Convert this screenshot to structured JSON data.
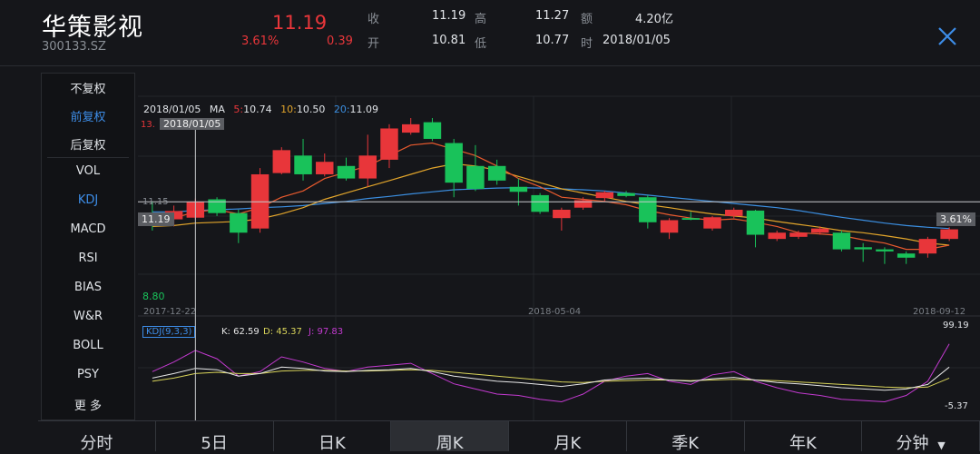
{
  "header": {
    "name": "华策影视",
    "code": "300133.SZ",
    "price": "11.19",
    "change_pct": "3.61%",
    "change_amt": "0.39",
    "stats": [
      {
        "label": "收",
        "value": "11.19"
      },
      {
        "label": "高",
        "value": "11.27"
      },
      {
        "label": "额",
        "value": "4.20亿"
      },
      {
        "label": "开",
        "value": "10.81"
      },
      {
        "label": "低",
        "value": "10.77"
      },
      {
        "label": "时",
        "value": "2018/01/05"
      }
    ]
  },
  "side_menu": {
    "rights": [
      "不复权",
      "前复权",
      "后复权"
    ],
    "indicators": [
      "VOL",
      "KDJ",
      "MACD",
      "RSI",
      "BIAS",
      "W&R",
      "BOLL",
      "PSY",
      "更 多"
    ],
    "active_right": "前复权",
    "active_indicator": "KDJ"
  },
  "overlay": {
    "date": "2018/01/05",
    "ma_label": "MA",
    "ma5_label": "5:",
    "ma5": "10.74",
    "ma10_label": "10:",
    "ma10": "10.50",
    "ma20_label": "20:",
    "ma20": "11.09",
    "crosshair_date": "2018/01/05",
    "crosshair_price": "11.19",
    "crosshair_pct": "3.61%",
    "top_price": "13.",
    "level_price": "11.15",
    "low_price": "8.80",
    "x_dates": [
      "2017-12-22",
      "2018-05-04",
      "2018-09-12"
    ],
    "kdj_name": "KDJ(9,3,3)",
    "kdj_k": "K: 62.59",
    "kdj_d": "D: 45.37",
    "kdj_j": "J: 97.83",
    "kdj_max": "99.19",
    "kdj_min": "-5.37"
  },
  "colors": {
    "up": "#e8363a",
    "down": "#19c25a",
    "ma5": "#e85a2e",
    "ma10": "#e2a52b",
    "ma20": "#3b8ee0",
    "k": "#e8e8e8",
    "d": "#d9d45a",
    "j": "#c33ad0",
    "accent": "#3d8de8"
  },
  "chart_data": {
    "type": "candlestick",
    "y_range": [
      8.8,
      13.2
    ],
    "candles": [
      {
        "o": 10.92,
        "c": 10.75,
        "h": 11.2,
        "l": 10.5
      },
      {
        "o": 10.77,
        "c": 10.97,
        "h": 11.1,
        "l": 10.6
      },
      {
        "o": 10.81,
        "c": 11.19,
        "h": 11.27,
        "l": 10.77
      },
      {
        "o": 11.25,
        "c": 10.92,
        "h": 11.3,
        "l": 10.85
      },
      {
        "o": 10.92,
        "c": 10.45,
        "h": 11.0,
        "l": 10.2
      },
      {
        "o": 10.55,
        "c": 11.85,
        "h": 12.0,
        "l": 10.45
      },
      {
        "o": 11.88,
        "c": 12.43,
        "h": 12.5,
        "l": 11.85
      },
      {
        "o": 12.3,
        "c": 11.85,
        "h": 12.7,
        "l": 11.7
      },
      {
        "o": 11.85,
        "c": 12.15,
        "h": 12.35,
        "l": 11.8
      },
      {
        "o": 12.05,
        "c": 11.75,
        "h": 12.25,
        "l": 11.7
      },
      {
        "o": 11.75,
        "c": 12.3,
        "h": 12.8,
        "l": 11.55
      },
      {
        "o": 12.2,
        "c": 12.95,
        "h": 13.05,
        "l": 12.0
      },
      {
        "o": 12.85,
        "c": 13.05,
        "h": 13.2,
        "l": 12.8
      },
      {
        "o": 13.1,
        "c": 12.7,
        "h": 13.2,
        "l": 12.65
      },
      {
        "o": 12.6,
        "c": 11.65,
        "h": 12.7,
        "l": 11.3
      },
      {
        "o": 12.05,
        "c": 11.5,
        "h": 12.55,
        "l": 11.45
      },
      {
        "o": 12.05,
        "c": 11.7,
        "h": 12.2,
        "l": 11.6
      },
      {
        "o": 11.55,
        "c": 11.43,
        "h": 11.75,
        "l": 11.1
      },
      {
        "o": 11.35,
        "c": 10.95,
        "h": 11.4,
        "l": 10.9
      },
      {
        "o": 10.8,
        "c": 11.0,
        "h": 11.05,
        "l": 10.5
      },
      {
        "o": 11.05,
        "c": 11.23,
        "h": 11.3,
        "l": 11.0
      },
      {
        "o": 11.28,
        "c": 11.42,
        "h": 11.45,
        "l": 11.2
      },
      {
        "o": 11.4,
        "c": 11.33,
        "h": 11.45,
        "l": 11.3
      },
      {
        "o": 11.3,
        "c": 10.7,
        "h": 11.35,
        "l": 10.55
      },
      {
        "o": 10.45,
        "c": 10.75,
        "h": 10.8,
        "l": 10.3
      },
      {
        "o": 10.8,
        "c": 10.76,
        "h": 10.95,
        "l": 10.75
      },
      {
        "o": 10.55,
        "c": 10.82,
        "h": 10.85,
        "l": 10.5
      },
      {
        "o": 10.85,
        "c": 11.0,
        "h": 11.05,
        "l": 10.8
      },
      {
        "o": 10.98,
        "c": 10.4,
        "h": 11.0,
        "l": 10.1
      },
      {
        "o": 10.3,
        "c": 10.45,
        "h": 10.5,
        "l": 10.25
      },
      {
        "o": 10.35,
        "c": 10.45,
        "h": 10.5,
        "l": 10.3
      },
      {
        "o": 10.45,
        "c": 10.55,
        "h": 10.6,
        "l": 10.4
      },
      {
        "o": 10.45,
        "c": 10.05,
        "h": 10.5,
        "l": 10.0
      },
      {
        "o": 10.1,
        "c": 10.05,
        "h": 10.2,
        "l": 9.75
      },
      {
        "o": 10.05,
        "c": 10.0,
        "h": 10.1,
        "l": 9.7
      },
      {
        "o": 9.95,
        "c": 9.85,
        "h": 10.0,
        "l": 9.7
      },
      {
        "o": 9.95,
        "c": 10.3,
        "h": 10.35,
        "l": 9.85
      },
      {
        "o": 10.3,
        "c": 10.53,
        "h": 10.58,
        "l": 10.25
      }
    ],
    "ma5": [
      10.7,
      10.8,
      10.95,
      11.0,
      10.9,
      11.05,
      11.3,
      11.45,
      11.75,
      11.9,
      12.05,
      12.3,
      12.55,
      12.6,
      12.45,
      12.3,
      12.05,
      11.75,
      11.55,
      11.3,
      11.25,
      11.2,
      11.12,
      10.98,
      10.88,
      10.8,
      10.75,
      10.78,
      10.7,
      10.6,
      10.45,
      10.42,
      10.38,
      10.28,
      10.2,
      10.05,
      10.05,
      10.15
    ],
    "ma10": [
      10.6,
      10.62,
      10.68,
      10.7,
      10.72,
      10.78,
      10.9,
      11.05,
      11.25,
      11.4,
      11.55,
      11.7,
      11.85,
      12.0,
      12.1,
      12.05,
      11.95,
      11.8,
      11.65,
      11.5,
      11.4,
      11.3,
      11.2,
      11.12,
      11.05,
      10.97,
      10.9,
      10.85,
      10.8,
      10.72,
      10.65,
      10.58,
      10.5,
      10.45,
      10.38,
      10.3,
      10.2,
      10.15
    ],
    "ma20": [
      10.95,
      10.95,
      10.98,
      11.0,
      11.02,
      11.05,
      11.07,
      11.1,
      11.15,
      11.2,
      11.27,
      11.32,
      11.38,
      11.43,
      11.48,
      11.5,
      11.52,
      11.53,
      11.52,
      11.5,
      11.48,
      11.45,
      11.4,
      11.35,
      11.3,
      11.25,
      11.2,
      11.15,
      11.1,
      11.05,
      10.98,
      10.9,
      10.82,
      10.75,
      10.68,
      10.62,
      10.58,
      10.55
    ],
    "kdj": {
      "k": [
        45,
        52,
        60,
        58,
        48,
        52,
        62,
        60,
        56,
        55,
        57,
        58,
        60,
        55,
        48,
        44,
        40,
        38,
        35,
        32,
        36,
        42,
        44,
        45,
        42,
        40,
        44,
        46,
        42,
        38,
        36,
        33,
        30,
        28,
        26,
        28,
        35,
        62
      ],
      "d": [
        40,
        45,
        52,
        54,
        52,
        52,
        56,
        57,
        57,
        56,
        56,
        57,
        58,
        57,
        54,
        51,
        48,
        45,
        42,
        39,
        38,
        40,
        41,
        42,
        42,
        41,
        42,
        43,
        42,
        41,
        39,
        37,
        35,
        33,
        31,
        30,
        31,
        45
      ],
      "j": [
        55,
        70,
        88,
        75,
        48,
        55,
        78,
        70,
        60,
        55,
        62,
        65,
        68,
        52,
        36,
        28,
        20,
        18,
        12,
        8,
        20,
        40,
        48,
        52,
        40,
        35,
        50,
        55,
        40,
        30,
        22,
        18,
        12,
        10,
        8,
        18,
        40,
        98
      ]
    }
  },
  "tabs": [
    "分时",
    "5日",
    "日K",
    "周K",
    "月K",
    "季K",
    "年K",
    "分钟"
  ],
  "active_tab": "周K"
}
